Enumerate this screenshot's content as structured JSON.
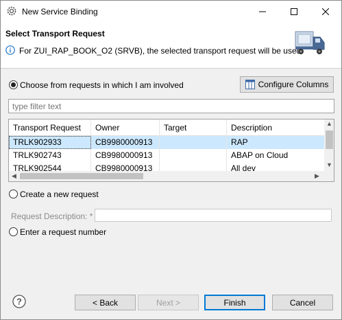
{
  "window": {
    "title": "New Service Binding"
  },
  "banner": {
    "title": "Select Transport Request",
    "message": "For ZUI_RAP_BOOK_O2 (SRVB), the selected transport request will be used"
  },
  "options": {
    "involved_label": "Choose from requests in which I am involved",
    "involved_selected": true,
    "configure_columns_label": "Configure Columns",
    "filter_placeholder": "type filter text",
    "create_label": "Create a new request",
    "request_description_label": "Request Description: *",
    "enter_label": "Enter a request number"
  },
  "table": {
    "columns": [
      "Transport Request",
      "Owner",
      "Target",
      "Description"
    ],
    "rows": [
      {
        "request": "TRLK902933",
        "owner": "CB9980000913",
        "target": "",
        "description": "RAP",
        "selected": true
      },
      {
        "request": "TRLK902743",
        "owner": "CB9980000913",
        "target": "",
        "description": "ABAP on Cloud",
        "selected": false
      },
      {
        "request": "TRLK902544",
        "owner": "CB9980000913",
        "target": "",
        "description": "All dev",
        "selected": false
      }
    ]
  },
  "footer": {
    "back_label": "< Back",
    "next_label": "Next >",
    "finish_label": "Finish",
    "cancel_label": "Cancel"
  },
  "icons": {
    "app": "settings-gear-icon",
    "info": "info-icon",
    "banner": "truck-icon",
    "configure": "columns-icon",
    "help": "help-icon"
  },
  "colors": {
    "selection": "#cce8ff",
    "default_button_border": "#0078d7",
    "info_blue": "#1a73c9"
  }
}
